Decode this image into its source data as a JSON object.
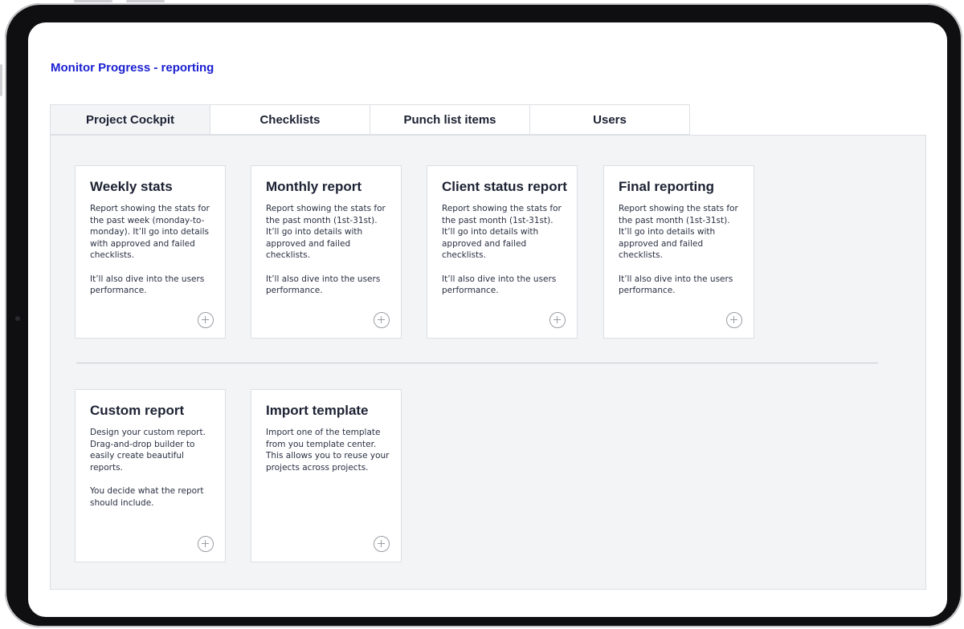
{
  "page": {
    "title": "Monitor Progress - reporting"
  },
  "tabs": [
    {
      "label": "Project Cockpit",
      "active": true
    },
    {
      "label": "Checklists",
      "active": false
    },
    {
      "label": "Punch list items",
      "active": false
    },
    {
      "label": "Users",
      "active": false
    }
  ],
  "cards": [
    {
      "title": "Weekly stats",
      "desc1": "Report showing the stats for the past week (monday-to-monday). It’ll go into details with approved and failed checklists.",
      "desc2": "It’ll also dive into the users performance."
    },
    {
      "title": "Monthly report",
      "desc1": "Report showing the stats for the past month (1st-31st). It’ll go into details with approved and failed checklists.",
      "desc2": "It’ll also dive into the users performance."
    },
    {
      "title": "Client status report",
      "desc1": "Report showing the stats for the past month (1st-31st). It’ll go into details with approved and failed checklists.",
      "desc2": "It’ll also dive into the users performance."
    },
    {
      "title": "Final reporting",
      "desc1": "Report showing the stats for the past month (1st-31st). It’ll go into details with approved and failed checklists.",
      "desc2": "It’ll also dive into the users performance."
    },
    {
      "title": "Custom report",
      "desc1": "Design your custom report. Drag-and-drop builder to easily create beautiful reports.",
      "desc2": "You decide what the report should include."
    },
    {
      "title": "Import template",
      "desc1": "Import one of the template from you template center. This allows you to reuse your projects across projects.",
      "desc2": ""
    }
  ],
  "icons": {
    "add": "plus-circle-icon"
  },
  "colors": {
    "accent": "#1a1fd1",
    "panel_bg": "#f3f4f6",
    "border": "#dcdfe4",
    "text": "#1c2233"
  }
}
